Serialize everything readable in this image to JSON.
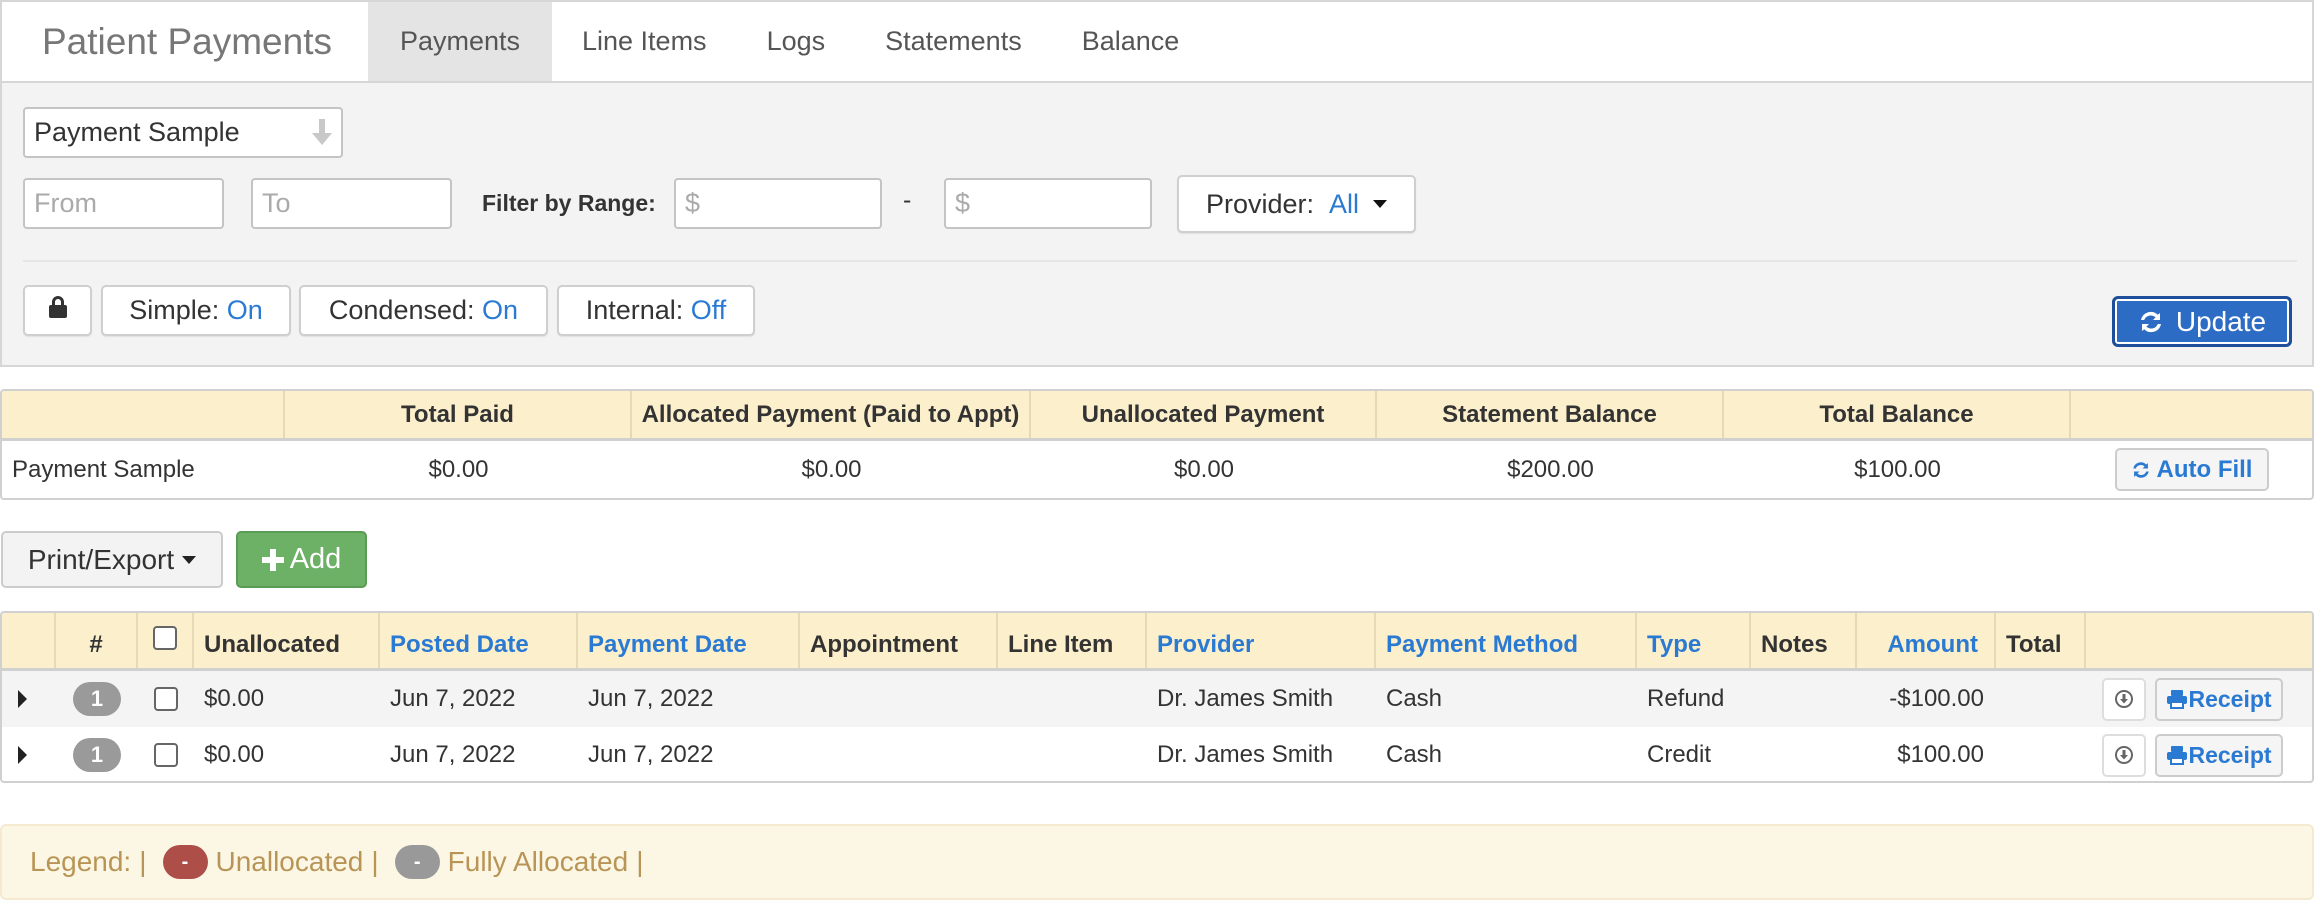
{
  "app": {
    "title": "Patient Payments",
    "tabs": [
      {
        "label": "Payments",
        "active": true
      },
      {
        "label": "Line Items",
        "active": false
      },
      {
        "label": "Logs",
        "active": false
      },
      {
        "label": "Statements",
        "active": false
      },
      {
        "label": "Balance",
        "active": false
      }
    ]
  },
  "filters": {
    "patient_select": "Payment Sample",
    "from_placeholder": "From",
    "to_placeholder": "To",
    "range_label": "Filter by Range:",
    "range_min_placeholder": "$",
    "range_dash": "-",
    "range_max_placeholder": "$",
    "provider_label": "Provider:",
    "provider_value": "All",
    "toggles": [
      {
        "label": "Simple:",
        "value": "On"
      },
      {
        "label": "Condensed:",
        "value": "On"
      },
      {
        "label": "Internal:",
        "value": "Off"
      }
    ],
    "update_label": "Update"
  },
  "summary": {
    "headers": [
      "",
      "Total Paid",
      "Allocated Payment (Paid to Appt)",
      "Unallocated Payment",
      "Statement Balance",
      "Total Balance",
      ""
    ],
    "row": {
      "name": "Payment Sample",
      "total_paid": "$0.00",
      "allocated": "$0.00",
      "unallocated": "$0.00",
      "statement_balance": "$200.00",
      "total_balance": "$100.00"
    },
    "autofill_label": "Auto Fill"
  },
  "actions": {
    "print_export_label": "Print/Export",
    "add_label": "Add"
  },
  "payments": {
    "headers": {
      "num": "#",
      "unallocated": "Unallocated",
      "posted_date": "Posted Date",
      "payment_date": "Payment Date",
      "appointment": "Appointment",
      "line_item": "Line Item",
      "provider": "Provider",
      "payment_method": "Payment Method",
      "type": "Type",
      "notes": "Notes",
      "amount": "Amount",
      "total": "Total"
    },
    "rows": [
      {
        "badge": "1",
        "unallocated": "$0.00",
        "posted_date": "Jun 7, 2022",
        "payment_date": "Jun 7, 2022",
        "appointment": "",
        "line_item": "",
        "provider": "Dr. James Smith",
        "payment_method": "Cash",
        "type": "Refund",
        "notes": "",
        "amount": "-$100.00",
        "total": "",
        "receipt_label": "Receipt"
      },
      {
        "badge": "1",
        "unallocated": "$0.00",
        "posted_date": "Jun 7, 2022",
        "payment_date": "Jun 7, 2022",
        "appointment": "",
        "line_item": "",
        "provider": "Dr. James Smith",
        "payment_method": "Cash",
        "type": "Credit",
        "notes": "",
        "amount": "$100.00",
        "total": "",
        "receipt_label": "Receipt"
      }
    ]
  },
  "legend": {
    "label": "Legend:",
    "sep": "|",
    "items": [
      {
        "badge": "-",
        "label": "Unallocated",
        "color": "#ad4e48"
      },
      {
        "badge": "-",
        "label": "Fully Allocated",
        "color": "#999999"
      }
    ]
  },
  "colors": {
    "accent": "#2a7ad3",
    "update_button": "#2d6cc4",
    "add_button": "#6cb166",
    "table_header": "#fcefcc",
    "legend_bg": "#fcf7e5"
  }
}
